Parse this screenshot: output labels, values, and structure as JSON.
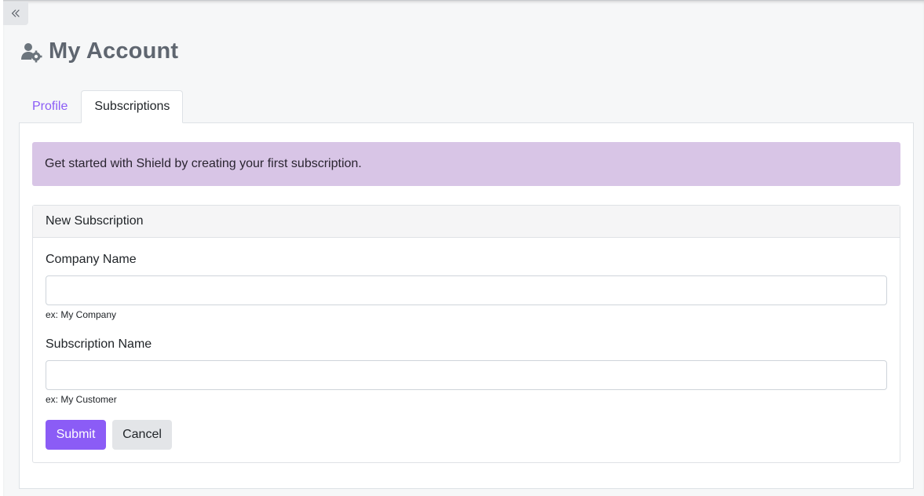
{
  "sidebar_toggle": {
    "icon": "double-chevron-left-icon"
  },
  "header": {
    "title": "My Account",
    "icon": "user-gear-icon"
  },
  "tabs": [
    {
      "label": "Profile",
      "active": false
    },
    {
      "label": "Subscriptions",
      "active": true
    }
  ],
  "alert": {
    "message": "Get started with Shield by creating your first subscription."
  },
  "new_subscription": {
    "heading": "New Subscription",
    "company_name": {
      "label": "Company Name",
      "value": "",
      "hint": "ex: My Company"
    },
    "subscription_name": {
      "label": "Subscription Name",
      "value": "",
      "hint": "ex: My Customer"
    },
    "submit_label": "Submit",
    "cancel_label": "Cancel"
  },
  "colors": {
    "accent": "#8b5cf6",
    "alert_bg": "#d8c5e6",
    "title": "#5f6670"
  }
}
